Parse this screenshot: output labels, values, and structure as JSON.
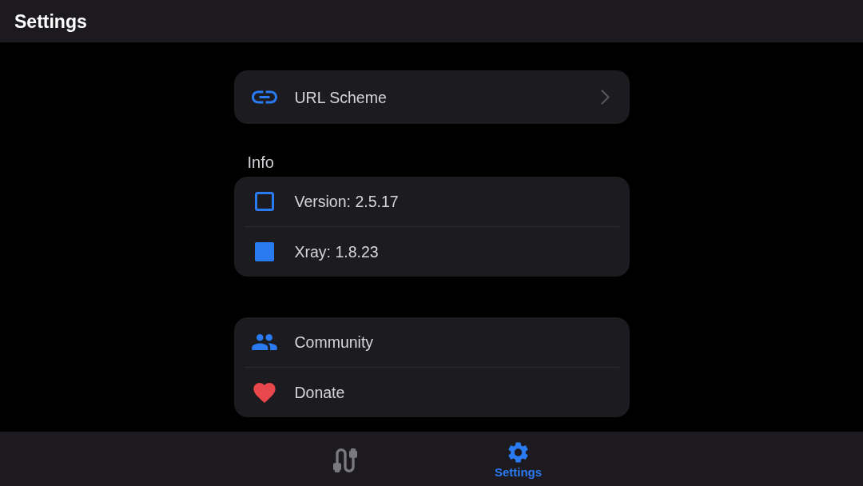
{
  "app_bar": {
    "title": "Settings"
  },
  "sections": [
    {
      "rows": [
        {
          "label": "URL Scheme",
          "kind": "nav"
        }
      ]
    },
    {
      "title": "Info",
      "rows": [
        {
          "label": "Version: 2.5.17",
          "kind": "plain"
        },
        {
          "label": "Xray: 1.8.23",
          "kind": "plain"
        }
      ]
    },
    {
      "rows": [
        {
          "label": "Community",
          "kind": "plain"
        },
        {
          "label": "Donate",
          "kind": "plain"
        }
      ]
    }
  ],
  "tabs": [
    {
      "selected": false
    },
    {
      "label": "Settings",
      "selected": true
    }
  ]
}
